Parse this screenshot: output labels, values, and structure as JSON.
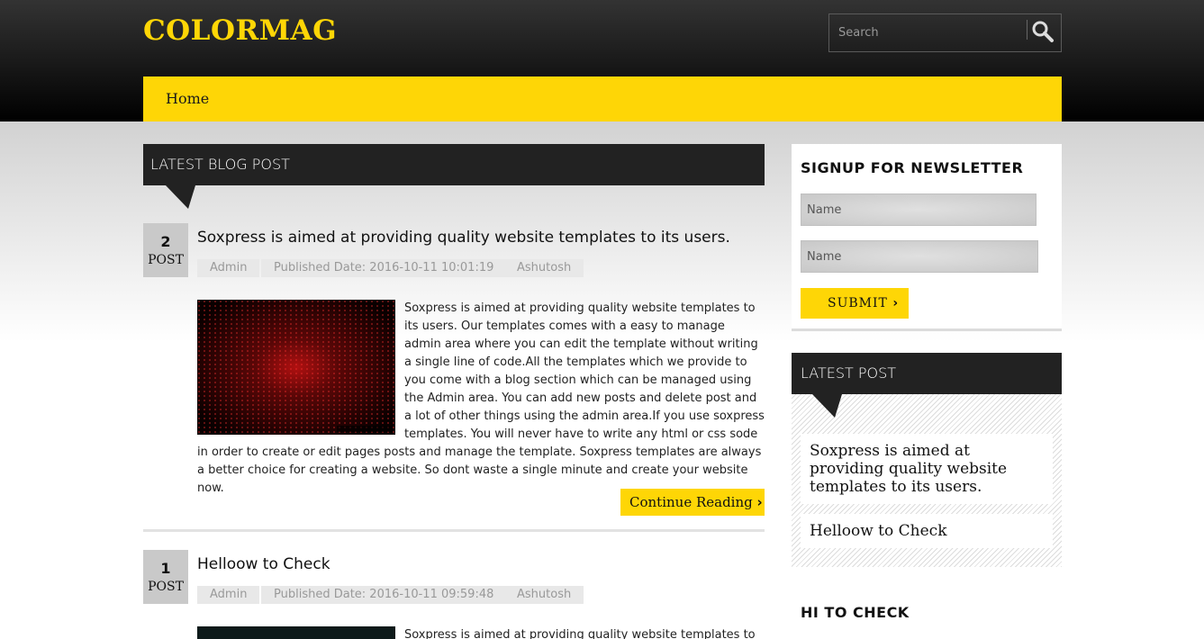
{
  "header": {
    "logo": "COLORMAG",
    "search_placeholder": "Search"
  },
  "nav": {
    "items": [
      "Home"
    ]
  },
  "main": {
    "section_title": "LATEST BLOG POST",
    "posts": [
      {
        "number": "2",
        "number_label": "POST",
        "title": "Soxpress is aimed at providing quality website templates to its users.",
        "author": "Admin",
        "published": "Published Date: 2016-10-11 10:01:19",
        "user": "Ashutosh",
        "excerpt": "Soxpress is aimed at providing quality website templates to its users. Our templates comes with a easy to manage admin area where you can edit the template without writing a single line of code.All the templates which we provide to you come with a blog section which can be managed using the Admin area. You can add new posts and delete post and a lot of other things using the admin area.If you use soxpress templates. You will never have to write any html or css sode in order to create or edit pages posts and manage the template. Soxpress templates are always a better choice for creating a website. So dont waste a single minute and create your website now.",
        "continue_label": "Continue Reading"
      },
      {
        "number": "1",
        "number_label": "POST",
        "title": "Helloow to Check",
        "author": "Admin",
        "published": "Published Date: 2016-10-11 09:59:48",
        "user": "Ashutosh",
        "excerpt": "Soxpress is aimed at providing quality website templates to its"
      }
    ]
  },
  "sidebar": {
    "newsletter_title": "SIGNUP FOR NEWSLETTER",
    "name_placeholder_1": "Name",
    "name_placeholder_2": "Name",
    "submit_label": "SUBMIT",
    "latest_post_title": "LATEST POST",
    "latest_posts": [
      "Soxpress is aimed at providing quality website templates to its users.",
      "Helloow to Check"
    ],
    "hi_title": "HI TO CHECK"
  },
  "colors": {
    "accent": "#fed606",
    "dark": "#222222"
  }
}
